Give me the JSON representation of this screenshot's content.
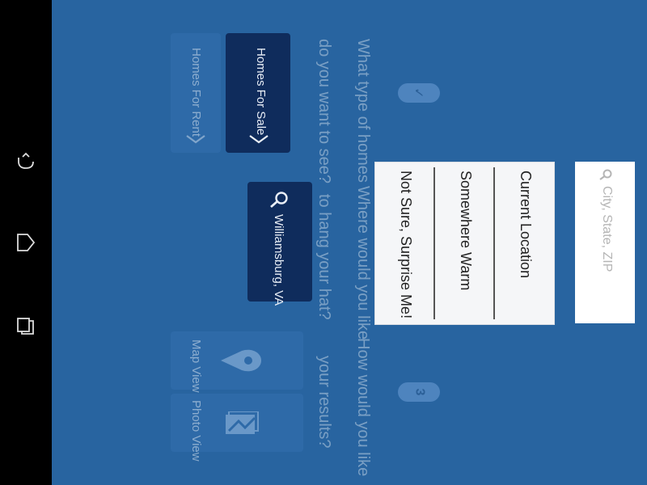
{
  "steps": {
    "step1": {
      "number": "✓",
      "question_line1": "What type of homes",
      "question_line2": "do you want to see?"
    },
    "step2": {
      "question_line1": "Where would you like",
      "question_line2": "to hang your hat?"
    },
    "step3": {
      "number": "3",
      "question_line1": "How would you like",
      "question_line2": "your results?"
    }
  },
  "home_type": {
    "options": [
      {
        "label": "Homes For Sale",
        "selected": true
      },
      {
        "label": "Homes For Rent",
        "selected": false
      }
    ]
  },
  "location": {
    "selected_value": "Williamsburg, VA",
    "search_placeholder": "City, State, ZIP",
    "dropdown_items": [
      {
        "label": "Current Location"
      },
      {
        "label": "Somewhere Warm"
      },
      {
        "label": "Not Sure, Surprise Me!"
      }
    ]
  },
  "results_view": {
    "options": [
      {
        "label": "Map View",
        "icon": "map-pin-icon"
      },
      {
        "label": "Photo View",
        "icon": "photo-icon"
      }
    ]
  },
  "system_nav": {
    "icons": [
      "back-icon",
      "home-icon",
      "recent-apps-icon"
    ]
  },
  "colors": {
    "app_background": "#2864a0",
    "selected_tile": "#0f2c5c",
    "unselected_tile": "#2e6aa8",
    "nav_bar": "#000000"
  }
}
